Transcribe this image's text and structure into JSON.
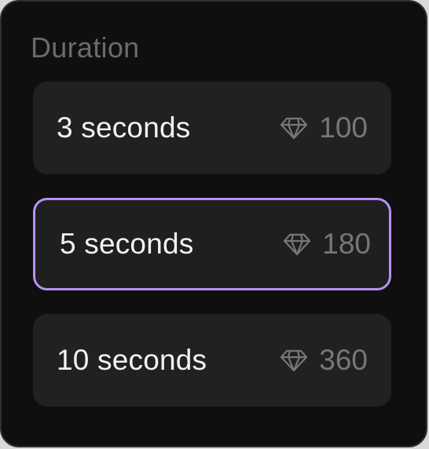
{
  "section": {
    "title": "Duration"
  },
  "options": [
    {
      "label": "3 seconds",
      "cost": "100",
      "icon": "diamond-icon",
      "selected": false
    },
    {
      "label": "5 seconds",
      "cost": "180",
      "icon": "diamond-icon",
      "selected": true
    },
    {
      "label": "10 seconds",
      "cost": "360",
      "icon": "diamond-icon",
      "selected": false
    }
  ],
  "colors": {
    "background": "#0f0f0f",
    "card": "#212121",
    "accent": "#b493f3",
    "muted_text": "#777777",
    "primary_text": "#f2f2f2"
  }
}
